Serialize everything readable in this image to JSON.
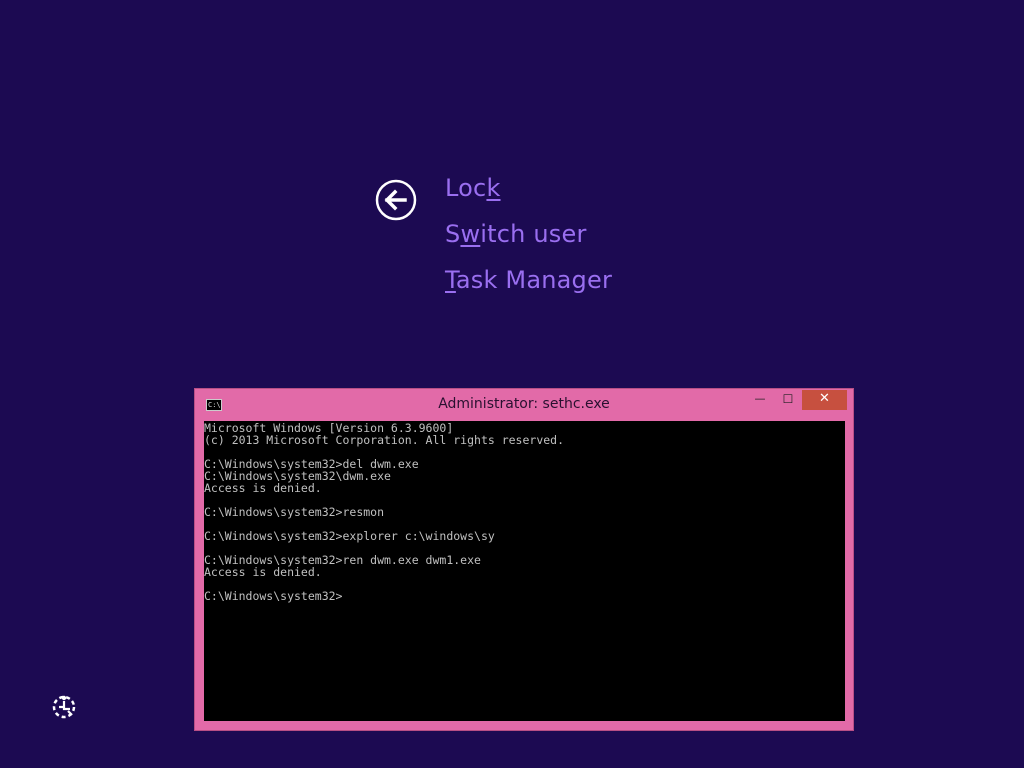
{
  "background_color": "#1c0a52",
  "accent_color": "#9a6ff0",
  "back_button": {
    "icon": "arrow-left-circle-icon"
  },
  "menu": {
    "lock": {
      "pre": "Loc",
      "key": "k",
      "post": ""
    },
    "switch_user": {
      "pre": "S",
      "key": "w",
      "post": "itch user"
    },
    "task_manager": {
      "pre": "",
      "key": "T",
      "post": "ask Manager"
    }
  },
  "ease_of_access": {
    "icon": "ease-of-access-icon"
  },
  "cmd_window": {
    "title": "Administrator: sethc.exe",
    "sys_icon_text": "C:\\",
    "frame_color": "#e26aa8",
    "close_color": "#c7503f",
    "buttons": {
      "minimize": "—",
      "maximize": "☐",
      "close": "✕"
    },
    "output": "Microsoft Windows [Version 6.3.9600]\n(c) 2013 Microsoft Corporation. All rights reserved.\n\nC:\\Windows\\system32>del dwm.exe\nC:\\Windows\\system32\\dwm.exe\nAccess is denied.\n\nC:\\Windows\\system32>resmon\n\nC:\\Windows\\system32>explorer c:\\windows\\sy\n\nC:\\Windows\\system32>ren dwm.exe dwm1.exe\nAccess is denied.\n\nC:\\Windows\\system32>"
  }
}
